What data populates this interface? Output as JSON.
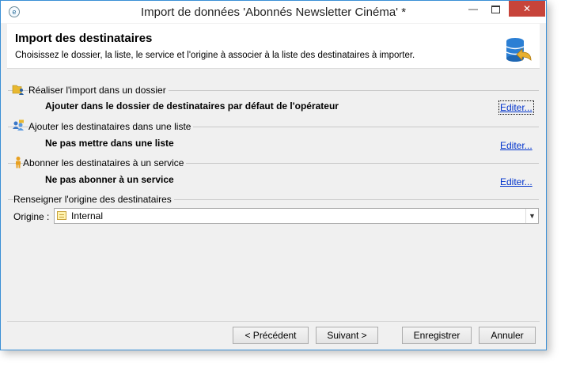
{
  "window": {
    "title": "Import de données 'Abonnés Newsletter Cinéma' *",
    "controls": {
      "minimize": "—",
      "close": "✕"
    }
  },
  "header": {
    "title": "Import des destinataires",
    "subtitle": "Choisissez le dossier, la liste, le service et l'origine à associer à la liste des destinataires à importer.",
    "icon": "database-import-icon"
  },
  "sections": {
    "folder": {
      "label": "Réaliser l'import dans un dossier",
      "value": "Ajouter dans le dossier de destinataires par défaut de l'opérateur",
      "edit": "Editer...",
      "icon": "folder-user-icon"
    },
    "list": {
      "label": "Ajouter les destinataires dans une liste",
      "value": "Ne pas mettre dans une liste",
      "edit": "Editer...",
      "icon": "users-group-icon"
    },
    "service": {
      "label": "Abonner les destinataires à un service",
      "value": "Ne pas abonner à un service",
      "edit": "Editer...",
      "icon": "person-icon"
    },
    "origin": {
      "label": "Renseigner l'origine des destinataires",
      "field_label": "Origine :",
      "selected": "Internal",
      "icon": "list-icon"
    }
  },
  "footer": {
    "prev": "< Précédent",
    "next": "Suivant >",
    "save": "Enregistrer",
    "cancel": "Annuler"
  }
}
